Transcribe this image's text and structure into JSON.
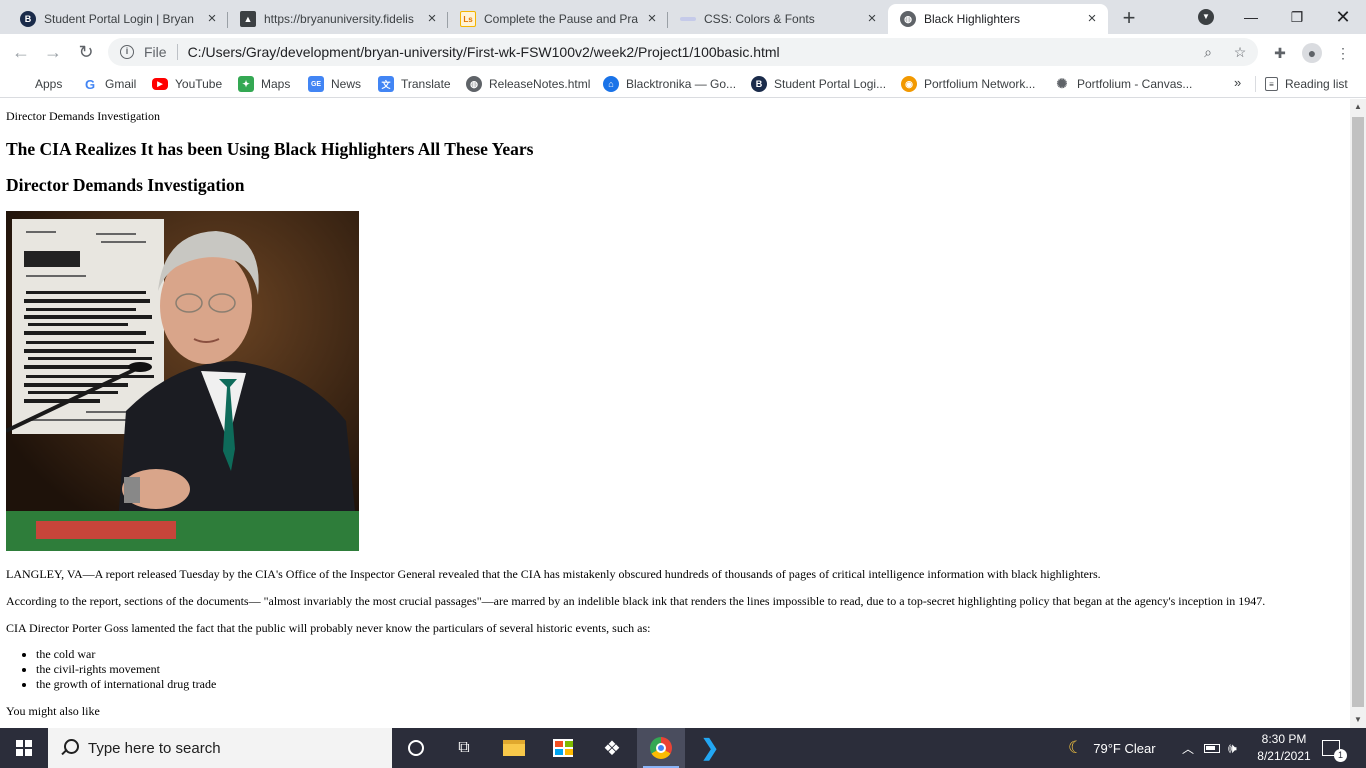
{
  "browser": {
    "tabs": [
      {
        "title": "Student Portal Login | Bryan U",
        "icon": "bryan-university-icon",
        "color": "#1a2b4a"
      },
      {
        "title": "https://bryanuniversity.fidelis",
        "icon": "fidelis-icon",
        "color": "#3c4043"
      },
      {
        "title": "Complete the Pause and Prac",
        "icon": "learn-icon",
        "color": "#f4b400"
      },
      {
        "title": "CSS: Colors & Fonts",
        "icon": "css-icon",
        "color": "#c5cae9"
      },
      {
        "title": "Black Highlighters",
        "icon": "globe-icon",
        "color": "#5f6368",
        "active": true
      }
    ],
    "address": {
      "info_label": "i",
      "scheme_label": "File",
      "url": "C:/Users/Gray/development/bryan-university/First-wk-FSW100v2/week2/Project1/100basic.html"
    },
    "bookmarks": [
      {
        "label": "Apps",
        "icon": "apps-grid-icon"
      },
      {
        "label": "Gmail",
        "icon": "google-icon"
      },
      {
        "label": "YouTube",
        "icon": "youtube-icon"
      },
      {
        "label": "Maps",
        "icon": "maps-icon"
      },
      {
        "label": "News",
        "icon": "news-icon"
      },
      {
        "label": "Translate",
        "icon": "translate-icon"
      },
      {
        "label": "ReleaseNotes.html",
        "icon": "globe-icon"
      },
      {
        "label": "Blacktronika — Go...",
        "icon": "institution-icon"
      },
      {
        "label": "Student Portal Logi...",
        "icon": "bryan-university-icon"
      },
      {
        "label": "Portfolium Network...",
        "icon": "portfolium-icon"
      },
      {
        "label": "Portfolium - Canvas...",
        "icon": "canvas-icon"
      }
    ],
    "bookmarks_more": "»",
    "reading_list": "Reading list"
  },
  "page": {
    "doc_title": "Director Demands Investigation",
    "headline": "The CIA Realizes It has been Using Black Highlighters All These Years",
    "subhead": "Director Demands Investigation",
    "paragraphs": [
      "LANGLEY, VA—A report released Tuesday by the CIA's Office of the Inspector General revealed that the CIA has mistakenly obscured hundreds of thousands of pages of critical intelligence information with black highlighters.",
      "According to the report, sections of the documents— \"almost invariably the most crucial passages\"—are marred by an indelible black ink that renders the lines impossible to read, due to a top-secret highlighting policy that began at the agency's inception in 1947.",
      "CIA Director Porter Goss lamented the fact that the public will probably never know the particulars of several historic events, such as:"
    ],
    "list": [
      "the cold war",
      "the civil-rights movement",
      "the growth of international drug trade"
    ],
    "more_label": "You might also like"
  },
  "taskbar": {
    "search_placeholder": "Type here to search",
    "weather": "79°F  Clear",
    "time": "8:30 PM",
    "date": "8/21/2021",
    "notification_count": "1"
  }
}
